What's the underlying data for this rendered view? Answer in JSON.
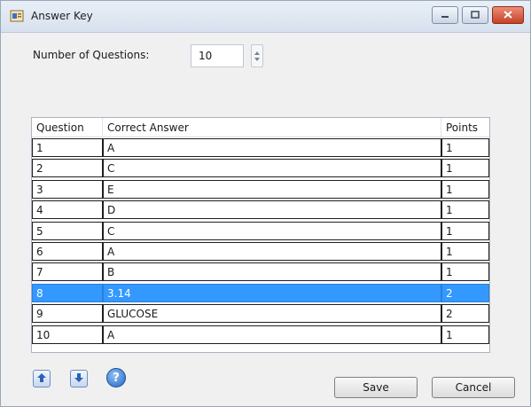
{
  "window": {
    "title": "Answer Key"
  },
  "form": {
    "num_questions_label": "Number of Questions:",
    "num_questions_value": "10"
  },
  "table": {
    "headers": {
      "question": "Question",
      "answer": "Correct Answer",
      "points": "Points"
    },
    "selected_row_index": 7,
    "rows": [
      {
        "question": "1",
        "answer": "A",
        "points": "1"
      },
      {
        "question": "2",
        "answer": "C",
        "points": "1"
      },
      {
        "question": "3",
        "answer": "E",
        "points": "1"
      },
      {
        "question": "4",
        "answer": "D",
        "points": "1"
      },
      {
        "question": "5",
        "answer": "C",
        "points": "1"
      },
      {
        "question": "6",
        "answer": "A",
        "points": "1"
      },
      {
        "question": "7",
        "answer": "B",
        "points": "1"
      },
      {
        "question": "8",
        "answer": "3.14",
        "points": "2"
      },
      {
        "question": "9",
        "answer": "GLUCOSE",
        "points": "2"
      },
      {
        "question": "10",
        "answer": "A",
        "points": "1"
      }
    ]
  },
  "toolbar": {
    "up_icon": "arrow-up-icon",
    "down_icon": "arrow-down-icon",
    "help_icon": "help-icon",
    "help_glyph": "?"
  },
  "actions": {
    "save_label": "Save",
    "cancel_label": "Cancel"
  },
  "colors": {
    "selection": "#3399ff",
    "close_button": "#c44126"
  }
}
